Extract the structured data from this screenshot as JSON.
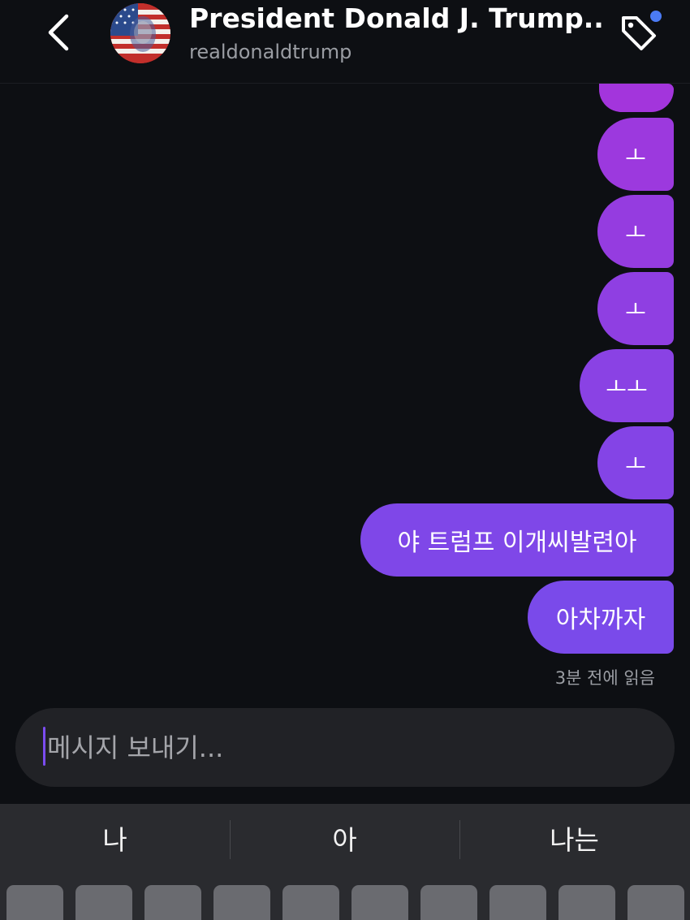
{
  "header": {
    "title": "President Donald J. Trump...",
    "username": "realdonaldtrump",
    "back_icon": "chevron-left-icon",
    "tag_icon": "tag-icon",
    "notification_color": "#4b7bf5"
  },
  "messages": [
    {
      "text": ""
    },
    {
      "text": "ㅗ"
    },
    {
      "text": "ㅗ"
    },
    {
      "text": "ㅗ"
    },
    {
      "text": "ㅗㅗ"
    },
    {
      "text": "ㅗ"
    },
    {
      "text": "야 트럼프 이개씨발련아"
    },
    {
      "text": "아차까자"
    }
  ],
  "read_receipt": "3분 전에 읽음",
  "composer": {
    "placeholder": "메시지 보내기..."
  },
  "keyboard": {
    "suggestions": [
      "나",
      "아",
      "나는"
    ]
  },
  "colors": {
    "background": "#0d0f13",
    "bubble_gradient_top": "#a335dc",
    "bubble_gradient_bottom": "#7a4aea"
  }
}
